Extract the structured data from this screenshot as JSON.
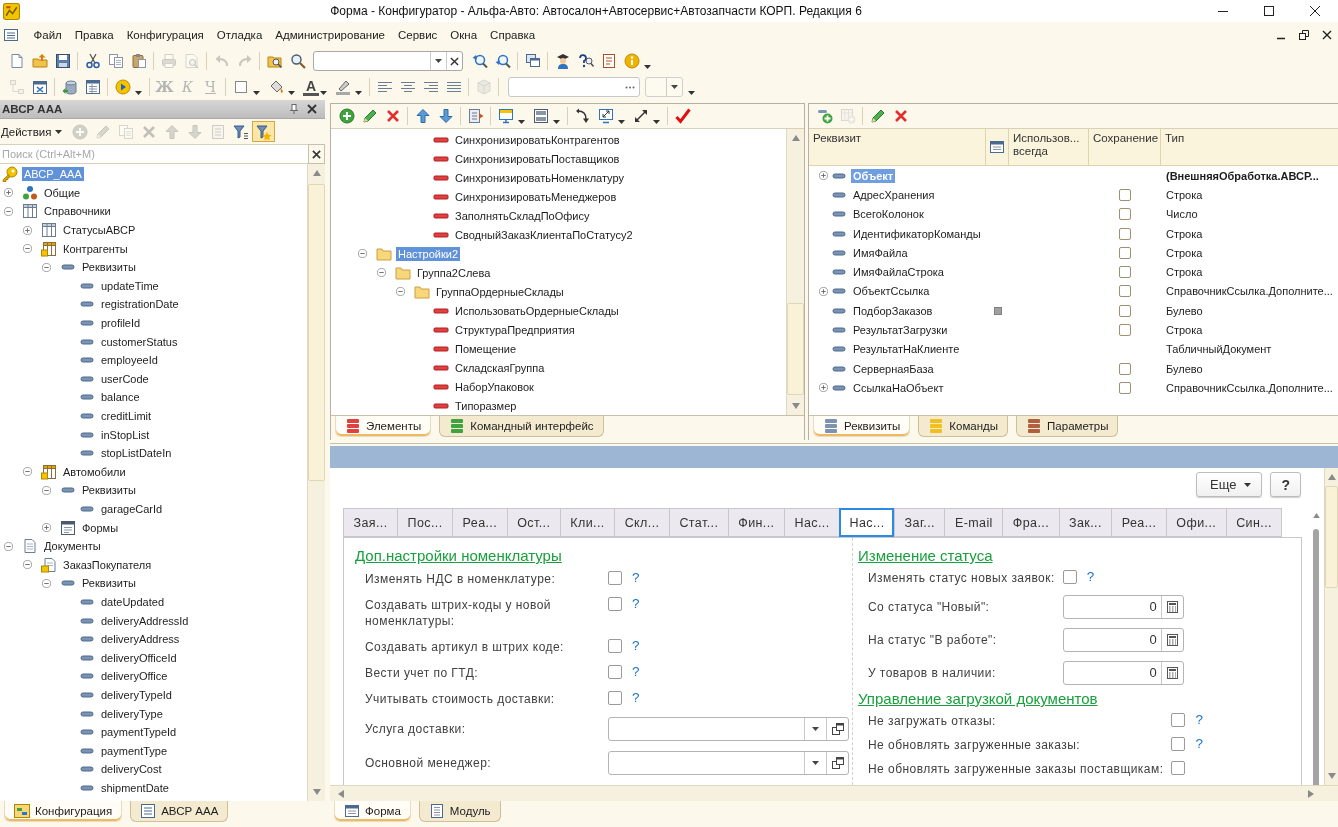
{
  "window": {
    "title": "Форма - Конфигуратор - Альфа-Авто: Автосалон+Автосервис+Автозапчасти КОРП. Редакция 6"
  },
  "menu": [
    "Файл",
    "Правка",
    "Конфигурация",
    "Отладка",
    "Администрирование",
    "Сервис",
    "Окна",
    "Справка"
  ],
  "main_toolbar": {
    "buttons": [
      {
        "disabled": false
      },
      {
        "disabled": false
      },
      {
        "disabled": false
      },
      {
        "disabled": false
      },
      {
        "disabled": false
      },
      {
        "disabled": false
      },
      {
        "disabled": true
      },
      {
        "disabled": true
      },
      {
        "disabled": true
      },
      {
        "disabled": true
      },
      {
        "disabled": false
      },
      {
        "disabled": false
      },
      {
        "disabled": false
      },
      {
        "disabled": false
      },
      {
        "disabled": false
      },
      {
        "disabled": false
      },
      {
        "disabled": false
      },
      {
        "disabled": false
      },
      {
        "disabled": false
      }
    ]
  },
  "format_toolbar": {
    "buttons": [
      {
        "disabled": true
      },
      {
        "disabled": false
      },
      {
        "disabled": false
      },
      {
        "disabled": false
      },
      {
        "disabled": false
      },
      {
        "disabled": false
      },
      {
        "disabled": false
      },
      {
        "disabled": false
      },
      {
        "disabled": false
      },
      {
        "disabled": false
      },
      {
        "disabled": false
      },
      {
        "disabled": false
      },
      {
        "disabled": true
      }
    ],
    "text_styles": [
      {
        "label": "Ж",
        "disabled": true
      },
      {
        "label": "К",
        "disabled": true
      },
      {
        "label": "Ч",
        "disabled": true
      }
    ],
    "font_color": {
      "label": "A"
    }
  },
  "object_panel": {
    "title": "АВСР ААА",
    "actions_label": "Действия",
    "actions": [
      {
        "disabled": true,
        "pressed": false
      },
      {
        "disabled": true,
        "pressed": false
      },
      {
        "disabled": true,
        "pressed": false
      },
      {
        "disabled": true,
        "pressed": false
      },
      {
        "disabled": true,
        "pressed": false
      },
      {
        "disabled": true,
        "pressed": false
      },
      {
        "disabled": true,
        "pressed": false
      },
      {
        "disabled": false,
        "pressed": false
      },
      {
        "disabled": false,
        "pressed": true
      }
    ],
    "search": {
      "placeholder": "Поиск (Ctrl+Alt+M)"
    },
    "tree": [
      {
        "kind": "root",
        "label": "АВСР_ААА",
        "selected": true,
        "children": [
          {
            "kind": "common",
            "label": "Общие",
            "expanded": false,
            "selected": false
          },
          {
            "kind": "catalogs",
            "label": "Справочники",
            "expanded": true,
            "selected": false,
            "children": [
              {
                "kind": "catalog",
                "label": "СтатусыАВСР",
                "adopted": false,
                "expanded": false,
                "selected": false
              },
              {
                "kind": "catalog",
                "label": "Контрагенты",
                "adopted": true,
                "expanded": true,
                "selected": false,
                "children": [
                  {
                    "kind": "attributes",
                    "label": "Реквизиты",
                    "expanded": true,
                    "selected": false,
                    "children": [
                      {
                        "kind": "attribute",
                        "label": "updateTime",
                        "selected": false
                      },
                      {
                        "kind": "attribute",
                        "label": "registrationDate",
                        "selected": false
                      },
                      {
                        "kind": "attribute",
                        "label": "profileId",
                        "selected": false
                      },
                      {
                        "kind": "attribute",
                        "label": "customerStatus",
                        "selected": false
                      },
                      {
                        "kind": "attribute",
                        "label": "employeeId",
                        "selected": false
                      },
                      {
                        "kind": "attribute",
                        "label": "userCode",
                        "selected": false
                      },
                      {
                        "kind": "attribute",
                        "label": "balance",
                        "selected": false
                      },
                      {
                        "kind": "attribute",
                        "label": "creditLimit",
                        "selected": false
                      },
                      {
                        "kind": "attribute",
                        "label": "inStopList",
                        "selected": false
                      },
                      {
                        "kind": "attribute",
                        "label": "stopListDateIn",
                        "selected": false
                      }
                    ]
                  }
                ]
              },
              {
                "kind": "catalog",
                "label": "Автомобили",
                "adopted": true,
                "expanded": true,
                "selected": false,
                "children": [
                  {
                    "kind": "attributes",
                    "label": "Реквизиты",
                    "expanded": true,
                    "selected": false,
                    "children": [
                      {
                        "kind": "attribute",
                        "label": "garageCarId",
                        "selected": false
                      }
                    ]
                  },
                  {
                    "kind": "forms",
                    "label": "Формы",
                    "expanded": false,
                    "selected": false
                  }
                ]
              }
            ]
          },
          {
            "kind": "documents",
            "label": "Документы",
            "expanded": true,
            "selected": false,
            "children": [
              {
                "kind": "document",
                "label": "ЗаказПокупателя",
                "adopted": true,
                "expanded": true,
                "selected": false,
                "children": [
                  {
                    "kind": "attributes",
                    "label": "Реквизиты",
                    "expanded": true,
                    "selected": false,
                    "children": [
                      {
                        "kind": "attribute",
                        "label": "dateUpdated",
                        "selected": false
                      },
                      {
                        "kind": "attribute",
                        "label": "deliveryAddressId",
                        "selected": false
                      },
                      {
                        "kind": "attribute",
                        "label": "deliveryAddress",
                        "selected": false
                      },
                      {
                        "kind": "attribute",
                        "label": "deliveryOfficeId",
                        "selected": false
                      },
                      {
                        "kind": "attribute",
                        "label": "deliveryOffice",
                        "selected": false
                      },
                      {
                        "kind": "attribute",
                        "label": "deliveryTypeId",
                        "selected": false
                      },
                      {
                        "kind": "attribute",
                        "label": "deliveryType",
                        "selected": false
                      },
                      {
                        "kind": "attribute",
                        "label": "paymentTypeId",
                        "selected": false
                      },
                      {
                        "kind": "attribute",
                        "label": "paymentType",
                        "selected": false
                      },
                      {
                        "kind": "attribute",
                        "label": "deliveryCost",
                        "selected": false
                      },
                      {
                        "kind": "attribute",
                        "label": "shipmentDate",
                        "selected": false
                      }
                    ]
                  }
                ]
              }
            ]
          }
        ]
      }
    ],
    "tabs": [
      {
        "label": "Конфигурация",
        "selected": true
      },
      {
        "label": "АВСР ААА",
        "selected": false
      }
    ]
  },
  "elements_panel": {
    "toolbar": {
      "buttons": [
        {
          "disabled": false
        },
        {
          "disabled": false
        },
        {
          "disabled": false
        },
        {
          "disabled": false
        },
        {
          "disabled": false
        },
        {
          "disabled": false
        },
        {
          "disabled": false
        },
        {
          "disabled": false
        },
        {
          "disabled": false
        },
        {
          "disabled": false
        },
        {
          "disabled": false
        },
        {
          "disabled": false
        }
      ]
    },
    "tree": [
      {
        "children": [
          {
            "children": [
              {
                "children": [
                  {
                    "kind": "field",
                    "label": "СинхронизироватьКонтрагентов",
                    "selected": false
                  },
                  {
                    "kind": "field",
                    "label": "СинхронизироватьПоставщиков",
                    "selected": false
                  },
                  {
                    "kind": "field",
                    "label": "СинхронизироватьНоменклатуру",
                    "selected": false
                  },
                  {
                    "kind": "field",
                    "label": "СинхронизироватьМенеджеров",
                    "selected": false
                  },
                  {
                    "kind": "field",
                    "label": "ЗаполнятьСкладПоОфису",
                    "selected": false
                  },
                  {
                    "kind": "field",
                    "label": "СводныйЗаказКлиентаПоСтатусу2",
                    "selected": false
                  }
                ]
              }
            ]
          }
        ]
      },
      {
        "kind": "group",
        "label": "Настройки2",
        "expanded": true,
        "selected": true,
        "children": [
          {
            "kind": "group",
            "label": "Группа2Слева",
            "expanded": true,
            "selected": false,
            "children": [
              {
                "kind": "group",
                "label": "ГруппаОрдерныеСклады",
                "expanded": true,
                "selected": false,
                "children": [
                  {
                    "kind": "field",
                    "label": "ИспользоватьОрдерныеСклады",
                    "selected": false
                  },
                  {
                    "kind": "field",
                    "label": "СтруктураПредприятия",
                    "selected": false
                  },
                  {
                    "kind": "field",
                    "label": "Помещение",
                    "selected": false
                  },
                  {
                    "kind": "field",
                    "label": "СкладскаяГруппа",
                    "selected": false
                  },
                  {
                    "kind": "field",
                    "label": "НаборУпаковок",
                    "selected": false
                  },
                  {
                    "kind": "field",
                    "label": "Типоразмер",
                    "selected": false
                  }
                ]
              }
            ]
          }
        ]
      }
    ],
    "tabs": [
      {
        "label": "Элементы",
        "selected": true
      },
      {
        "label": "Командный интерфейс",
        "selected": false
      }
    ]
  },
  "attributes_panel": {
    "toolbar": {
      "buttons": [
        {
          "disabled": false
        },
        {
          "disabled": true
        },
        {
          "disabled": false
        },
        {
          "disabled": false
        }
      ]
    },
    "table": {
      "columns": [
        {
          "kind": "text",
          "label": "Реквизит"
        },
        {
          "kind": "icon"
        },
        {
          "kind": "text",
          "label": "Использов... всегда"
        },
        {
          "kind": "text",
          "label": "Сохранение"
        },
        {
          "kind": "text",
          "label": "Тип"
        }
      ],
      "rows": [
        {
          "name": "Объект",
          "main": true,
          "expanded": false,
          "selected": true,
          "marker": false,
          "type": "(ВнешняяОбработка.АВСР..."
        },
        {
          "name": "АдресХранения",
          "main": false,
          "selected": false,
          "marker": false,
          "saved": false,
          "type": "Строка"
        },
        {
          "name": "ВсегоКолонок",
          "main": false,
          "selected": false,
          "marker": false,
          "saved": false,
          "type": "Число"
        },
        {
          "name": "ИдентификаторКоманды",
          "main": false,
          "selected": false,
          "marker": false,
          "saved": false,
          "type": "Строка"
        },
        {
          "name": "ИмяФайла",
          "main": false,
          "selected": false,
          "marker": false,
          "saved": false,
          "type": "Строка"
        },
        {
          "name": "ИмяФайлаСтрока",
          "main": false,
          "selected": false,
          "marker": false,
          "saved": false,
          "type": "Строка"
        },
        {
          "name": "ОбъектСсылка",
          "main": false,
          "expanded": false,
          "selected": false,
          "marker": false,
          "saved": false,
          "type": "СправочникСсылка.Дополните..."
        },
        {
          "name": "ПодборЗаказов",
          "main": false,
          "selected": false,
          "marker": true,
          "saved": false,
          "type": "Булево"
        },
        {
          "name": "РезультатЗагрузки",
          "main": false,
          "selected": false,
          "marker": false,
          "saved": false,
          "type": "Строка"
        },
        {
          "name": "РезультатНаКлиенте",
          "main": false,
          "selected": false,
          "marker": false,
          "type": "ТабличныйДокумент"
        },
        {
          "name": "СервернаяБаза",
          "main": false,
          "selected": false,
          "marker": false,
          "saved": false,
          "type": "Булево"
        },
        {
          "name": "СсылкаНаОбъект",
          "main": false,
          "expanded": false,
          "selected": false,
          "marker": false,
          "saved": false,
          "type": "СправочникСсылка.Дополните..."
        }
      ]
    },
    "tabs": [
      {
        "label": "Реквизиты",
        "selected": true
      },
      {
        "label": "Команды",
        "selected": false
      },
      {
        "label": "Параметры",
        "selected": false
      }
    ]
  },
  "form": {
    "more_button": "Еще",
    "help_button": "?",
    "tabs": [
      {
        "label": "Зая...",
        "selected": false
      },
      {
        "label": "Пос...",
        "selected": false
      },
      {
        "label": "Реа...",
        "selected": false
      },
      {
        "label": "Ост...",
        "selected": false
      },
      {
        "label": "Кли...",
        "selected": false
      },
      {
        "label": "Скл...",
        "selected": false
      },
      {
        "label": "Стат...",
        "selected": false
      },
      {
        "label": "Фин...",
        "selected": false
      },
      {
        "label": "Нас...",
        "selected": false
      },
      {
        "label": "Нас...",
        "selected": true
      },
      {
        "label": "Заг...",
        "selected": false
      },
      {
        "label": "E-mail",
        "selected": false
      },
      {
        "label": "Фра...",
        "selected": false
      },
      {
        "label": "Зак...",
        "selected": false
      },
      {
        "label": "Реа...",
        "selected": false
      },
      {
        "label": "Офи...",
        "selected": false
      },
      {
        "label": "Син...",
        "selected": false
      }
    ],
    "columns": [
      {
        "sections": [
          {
            "heading": "Доп.настройки номенклатуры",
            "rows": [
              {
                "kind": "checkbox",
                "label": "Изменять НДС в номенклатуре:",
                "checked": false,
                "help": "?"
              },
              {
                "kind": "checkbox",
                "label": "Создавать штрих-коды у новой номенклатуры:",
                "checked": false,
                "help": "?"
              },
              {
                "kind": "checkbox",
                "label": "Создавать артикул в штрих коде:",
                "checked": false,
                "help": "?"
              },
              {
                "kind": "checkbox",
                "label": "Вести учет по ГТД:",
                "checked": false,
                "help": "?"
              },
              {
                "kind": "checkbox",
                "label": "Учитывать стоимость доставки:",
                "checked": false,
                "help": "?"
              },
              {
                "kind": "combo",
                "label": "Услуга доставки:"
              },
              {
                "kind": "combo",
                "label": "Основной менеджер:"
              }
            ]
          }
        ]
      },
      {
        "sections": [
          {
            "heading": "Изменение статуса",
            "rows": [
              {
                "kind": "checkbox",
                "label": "Изменять статус новых заявок:",
                "checked": false,
                "help": "?"
              },
              {
                "kind": "number",
                "label": "Со статуса \"Новый\":",
                "value": "0"
              },
              {
                "kind": "number",
                "label": "На статус \"В работе\":",
                "value": "0"
              },
              {
                "kind": "number",
                "label": "У товаров в наличии:",
                "value": "0"
              }
            ]
          },
          {
            "heading": "Управление загрузкой документов",
            "rows": [
              {
                "kind": "checkbox",
                "label": "Не загружать отказы:",
                "checked": false,
                "help": "?"
              },
              {
                "kind": "checkbox",
                "label": "Не обновлять загруженные заказы:",
                "checked": false,
                "help": "?"
              },
              {
                "kind": "checkbox",
                "label": "Не обновлять загруженные заказы поставщикам:",
                "checked": false
              }
            ]
          }
        ]
      }
    ]
  },
  "bottom_tabs": [
    {
      "label": "Форма",
      "selected": true
    },
    {
      "label": "Модуль",
      "selected": false
    }
  ]
}
